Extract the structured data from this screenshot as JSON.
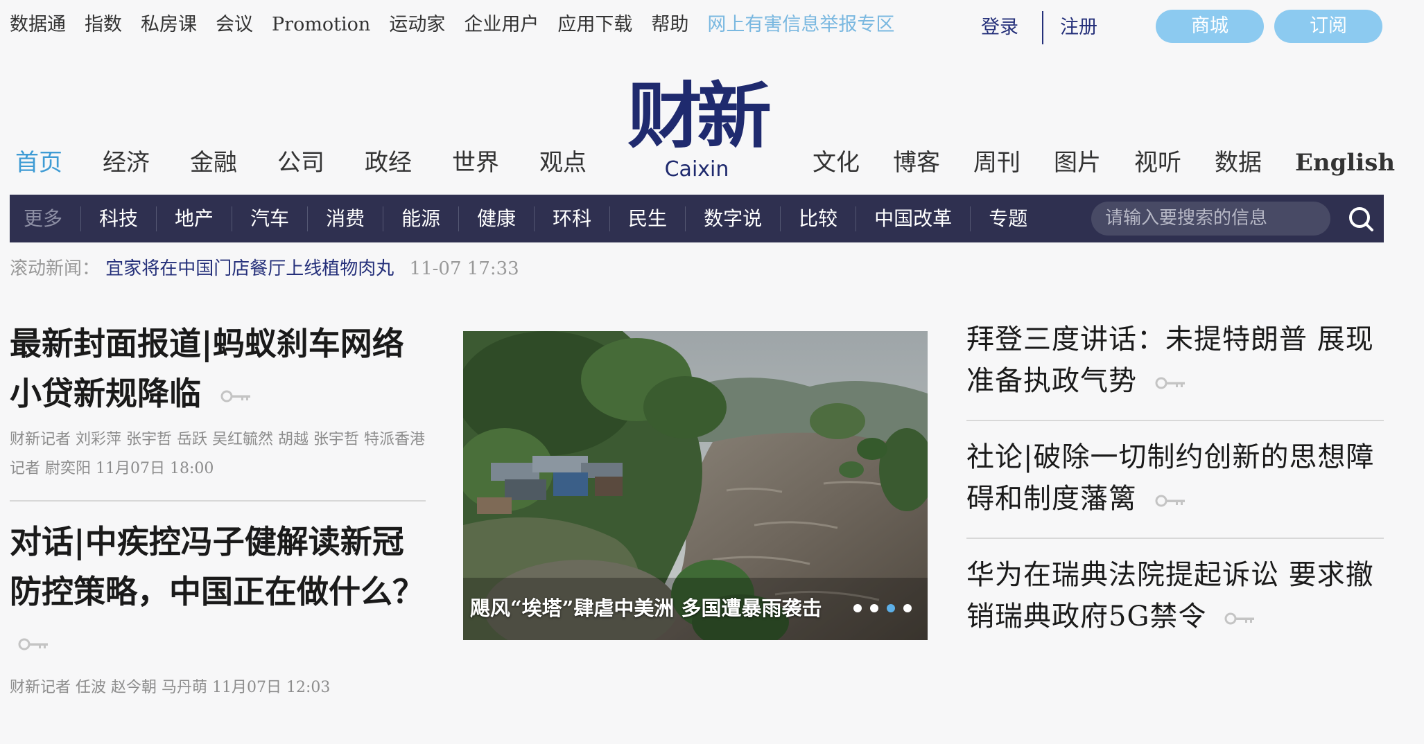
{
  "topnav": {
    "items": [
      "数据通",
      "指数",
      "私房课",
      "会议",
      "Promotion",
      "运动家",
      "企业用户",
      "应用下载",
      "帮助"
    ],
    "alert_link": "网上有害信息举报专区",
    "login": "登录",
    "register": "注册",
    "shop": "商城",
    "subscribe": "订阅"
  },
  "logo": {
    "cn": "财新",
    "en": "Caixin"
  },
  "mainnav": {
    "left": [
      "首页",
      "经济",
      "金融",
      "公司",
      "政经",
      "世界",
      "观点"
    ],
    "right": [
      "文化",
      "博客",
      "周刊",
      "图片",
      "视听",
      "数据",
      "English"
    ]
  },
  "subnav": {
    "more": "更多",
    "items": [
      "科技",
      "地产",
      "汽车",
      "消费",
      "能源",
      "健康",
      "环科",
      "民生",
      "数字说",
      "比较",
      "中国改革",
      "专题"
    ],
    "search_placeholder": "请输入要搜索的信息"
  },
  "ticker": {
    "label": "滚动新闻：",
    "headline": "宜家将在中国门店餐厅上线植物肉丸",
    "time": "11-07 17:33"
  },
  "left_stories": [
    {
      "title": "最新封面报道|蚂蚁刹车网络小贷新规降临",
      "meta": "财新记者 刘彩萍 张宇哲 岳跃 吴红毓然 胡越 张宇哲 特派香港记者 尉奕阳 11月07日 18:00"
    },
    {
      "title": "对话|中疾控冯子健解读新冠防控策略，中国正在做什么？",
      "meta": "财新记者 任波 赵今朝 马丹萌 11月07日 12:03"
    }
  ],
  "hero": {
    "caption": "飓风“埃塔”肆虐中美洲 多国遭暴雨袭击",
    "slide_count": 4,
    "active_slide": 3
  },
  "right_stories": [
    {
      "title": "拜登三度讲话：未提特朗普 展现准备执政气势"
    },
    {
      "title": "社论|破除一切制约创新的思想障碍和制度藩篱"
    },
    {
      "title": "华为在瑞典法院提起诉讼 要求撤销瑞典政府5G禁令"
    }
  ],
  "colors": {
    "brand_navy": "#1f2a6e",
    "subbar_bg": "#2f3050",
    "accent_blue": "#3e9bd4",
    "pill_blue": "#8ccaf0"
  }
}
